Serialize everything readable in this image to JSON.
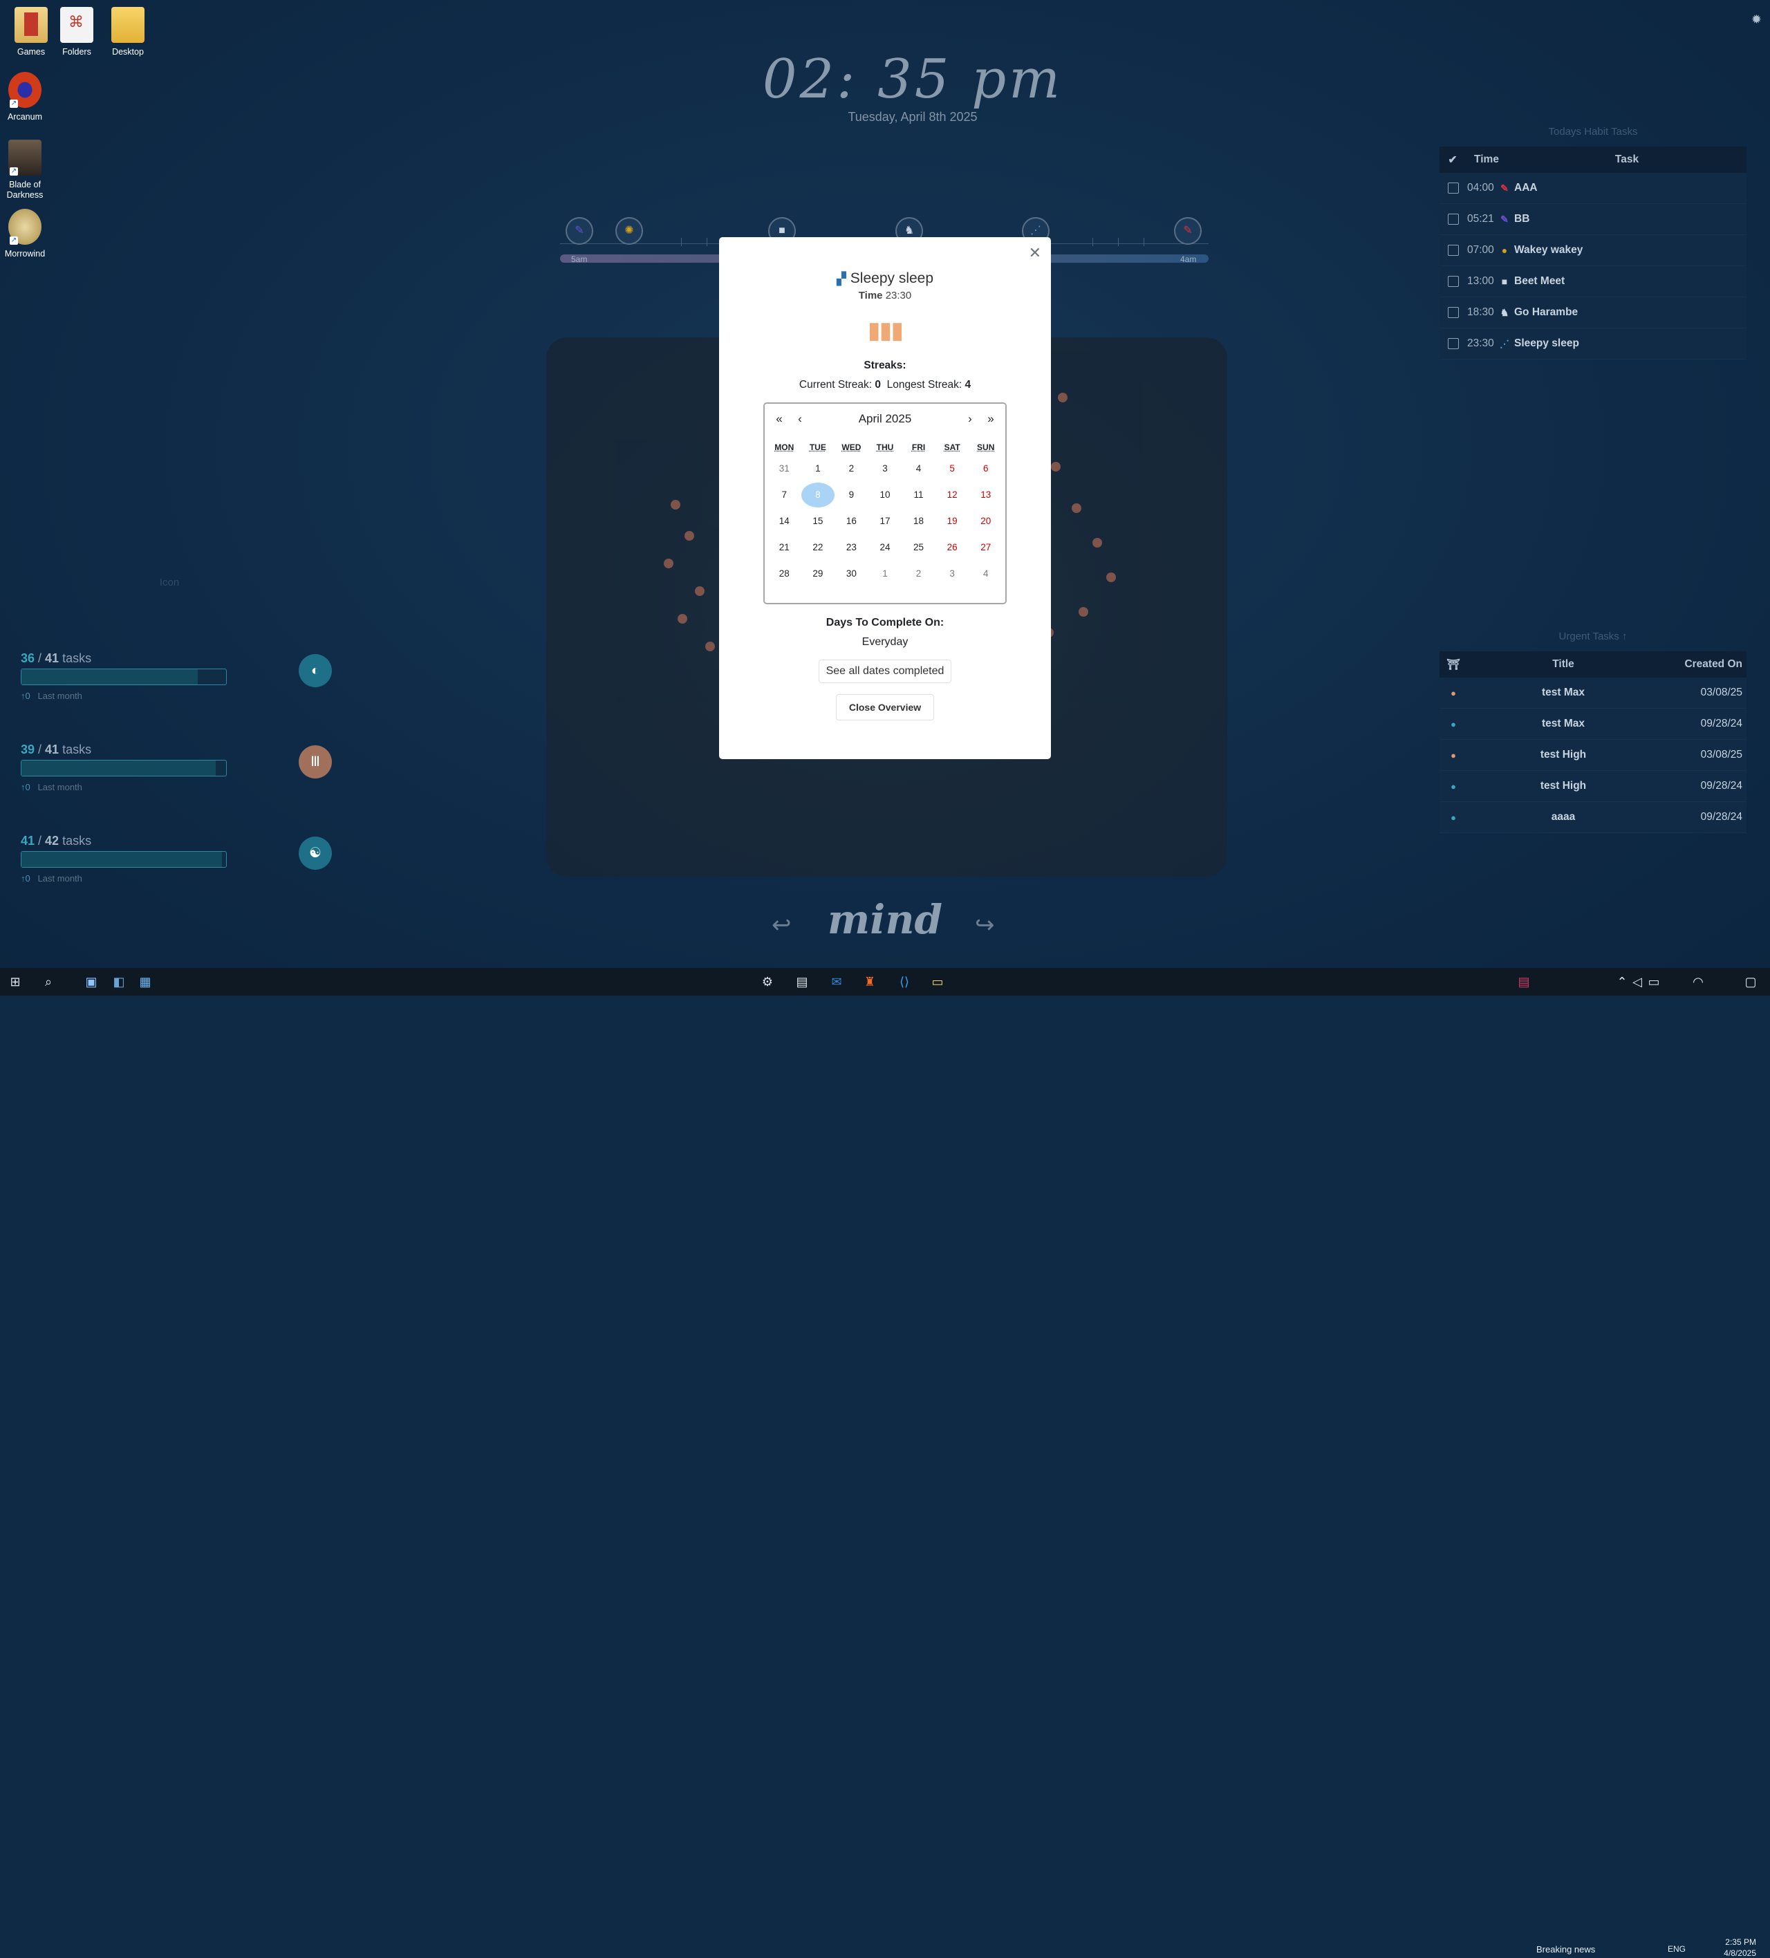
{
  "desktop": {
    "icons": [
      {
        "label": "Games"
      },
      {
        "label": "Folders"
      },
      {
        "label": "Desktop"
      },
      {
        "label": "Arcanum"
      },
      {
        "label": "Blade of Darkness"
      },
      {
        "label": "Morrowind"
      }
    ]
  },
  "clock": {
    "time": "02: 35 pm",
    "date": "Tuesday, April 8th 2025"
  },
  "timeline": {
    "start_label": "5am",
    "end_label": "4am"
  },
  "left_widgets": {
    "icon_caption": "Icon",
    "blocks": [
      {
        "done": "36",
        "total": "41",
        "unit": "tasks",
        "progress": 0.86,
        "change": "↑0",
        "period": "Last month",
        "badge_color": "#1e6f88"
      },
      {
        "done": "39",
        "total": "41",
        "unit": "tasks",
        "progress": 0.95,
        "change": "↑0",
        "period": "Last month",
        "badge_color": "#a0705b"
      },
      {
        "done": "41",
        "total": "42",
        "unit": "tasks",
        "progress": 0.98,
        "change": "↑0",
        "period": "Last month",
        "badge_color": "#1e6f88"
      }
    ]
  },
  "habit_panel": {
    "title": "Todays Habit Tasks",
    "col_time": "Time",
    "col_task": "Task",
    "rows": [
      {
        "time": "04:00",
        "task": "AAA",
        "icon": "✎",
        "color": "#d7303f"
      },
      {
        "time": "05:21",
        "task": "BB",
        "icon": "✎",
        "color": "#6a4fcf"
      },
      {
        "time": "07:00",
        "task": "Wakey wakey",
        "icon": "●",
        "color": "#d4a020"
      },
      {
        "time": "13:00",
        "task": "Beet Meet",
        "icon": "■",
        "color": "#c9d4df"
      },
      {
        "time": "18:30",
        "task": "Go Harambe",
        "icon": "♞",
        "color": "#c9d4df"
      },
      {
        "time": "23:30",
        "task": "Sleepy sleep",
        "icon": "⋰",
        "color": "#4aa3d8"
      }
    ]
  },
  "urgent_panel": {
    "title": "Urgent Tasks ↑",
    "col_title": "Title",
    "col_created": "Created On",
    "rows": [
      {
        "title": "test Max",
        "created": "03/08/25",
        "color": "#e09a70"
      },
      {
        "title": "test Max",
        "created": "09/28/24",
        "color": "#3aa7c0"
      },
      {
        "title": "test High",
        "created": "03/08/25",
        "color": "#e09a70"
      },
      {
        "title": "test High",
        "created": "09/28/24",
        "color": "#3aa7c0"
      },
      {
        "title": "aaaa",
        "created": "09/28/24",
        "color": "#3aa7c0"
      }
    ]
  },
  "modal": {
    "title": "Sleepy sleep",
    "time_label": "Time",
    "time_value": "23:30",
    "streaks_label": "Streaks:",
    "current_label": "Current Streak:",
    "current_value": "0",
    "longest_label": "Longest Streak:",
    "longest_value": "4",
    "calendar": {
      "prev_year": "«",
      "prev_month": "‹",
      "month": "April 2025",
      "next_month": "›",
      "next_year": "»",
      "days_of_week": [
        "MON",
        "TUE",
        "WED",
        "THU",
        "FRI",
        "SAT",
        "SUN"
      ],
      "weeks": [
        [
          "31",
          "1",
          "2",
          "3",
          "4",
          "5",
          "6"
        ],
        [
          "7",
          "8",
          "9",
          "10",
          "11",
          "12",
          "13"
        ],
        [
          "14",
          "15",
          "16",
          "17",
          "18",
          "19",
          "20"
        ],
        [
          "21",
          "22",
          "23",
          "24",
          "25",
          "26",
          "27"
        ],
        [
          "28",
          "29",
          "30",
          "1",
          "2",
          "3",
          "4"
        ]
      ],
      "selected": "8"
    },
    "days_label": "Days To Complete On:",
    "days_value": "Everyday",
    "see_dates_button": "See all dates completed",
    "close_button": "Close Overview"
  },
  "bottom": {
    "label": "mind"
  },
  "taskbar": {
    "news": "Breaking news",
    "lang": "ENG",
    "time": "2:35 PM",
    "date": "4/8/2025"
  }
}
